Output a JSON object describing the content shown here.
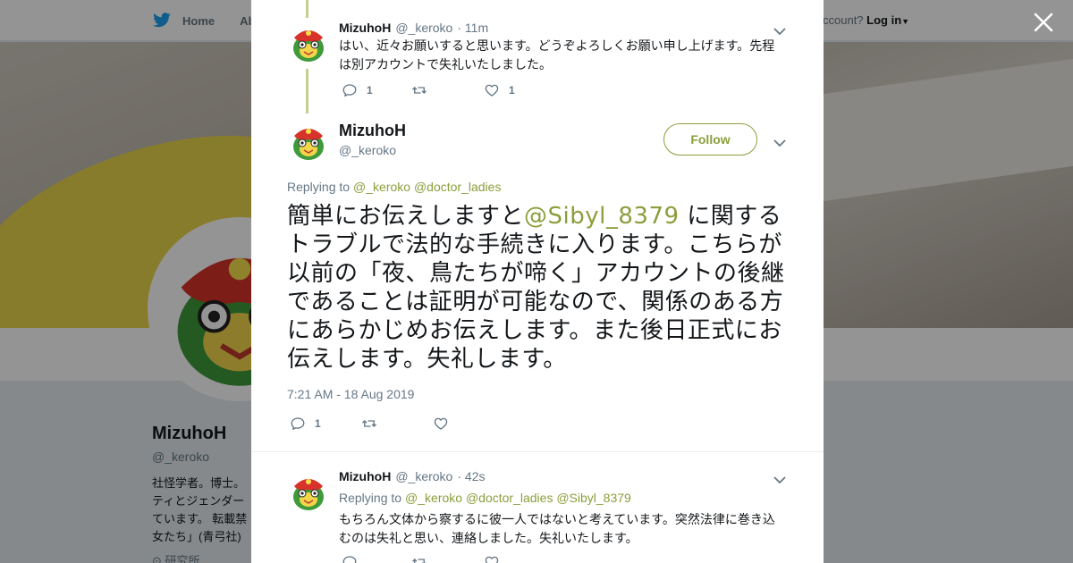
{
  "background": {
    "nav": {
      "home": "Home",
      "about": "Abo"
    },
    "account_prompt": "ccount?",
    "login": "Log in",
    "profile": {
      "name": "MizuhoH",
      "handle": "@_keroko",
      "bio": [
        "社怪学者。博士。",
        "ティとジェンダー",
        "ています。 転載禁",
        "女たち」(青弓社)"
      ],
      "foot": "⊙ 研究所"
    }
  },
  "modal": {
    "reply_tweet_top": {
      "name": "MizuhoH",
      "handle": "@_keroko",
      "time": "· 11m",
      "text": "はい、近々お願いすると思います。どうぞよろしくお願い申し上げます。先程は別アカウントで失礼いたしました。",
      "reply_count": "1",
      "retweet_count": "",
      "like_count": "1"
    },
    "main_tweet": {
      "name": "MizuhoH",
      "handle": "@_keroko",
      "follow_label": "Follow",
      "replying_to_label": "Replying to",
      "replying_to_users": "@_keroko @doctor_ladies",
      "text_before_mention": "簡単にお伝えしますと",
      "mention": "@Sibyl_8379",
      "text_after_mention": " に関するトラブルで法的な手続きに入ります。こちらが以前の「夜、鳥たちが啼く」アカウントの後継であることは証明が可能なので、関係のある方にあらかじめお伝えします。また後日正式にお伝えします。失礼します。",
      "timestamp": "7:21 AM - 18 Aug 2019",
      "reply_count": "1",
      "retweet_count": "",
      "like_count": ""
    },
    "reply_tweet_bottom": {
      "name": "MizuhoH",
      "handle": "@_keroko",
      "time": "· 42s",
      "replying_to_label": "Replying to",
      "replying_to_users": "@_keroko @doctor_ladies @Sibyl_8379",
      "text": "もちろん文体から察するに彼一人ではないと考えています。突然法律に巻き込むのは失礼と思い、連絡しました。失礼いたします。"
    }
  },
  "icons": {
    "close": "close-icon",
    "reply": "reply-icon",
    "retweet": "retweet-icon",
    "like": "heart-icon",
    "more": "chevron-down-icon",
    "brand": "twitter-bird-icon"
  },
  "colors": {
    "accent": "#8b9e3c",
    "thread_line": "#c4d18e",
    "muted": "#657786"
  }
}
